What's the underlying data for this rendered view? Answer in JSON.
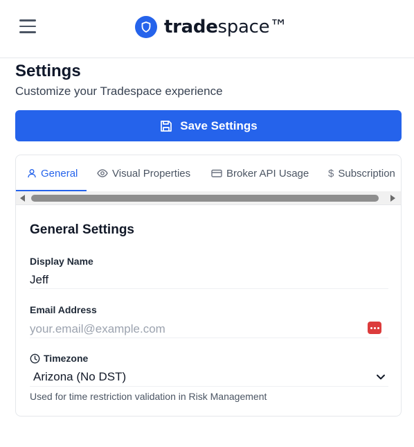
{
  "header": {
    "logo_bold": "trade",
    "logo_light": "space™",
    "menu_icon": "hamburger-menu-icon",
    "logo_icon": "shield-icon"
  },
  "page": {
    "title": "Settings",
    "subtitle": "Customize your Tradespace experience"
  },
  "save_button": {
    "label": "Save Settings",
    "icon": "floppy-disk-icon"
  },
  "tabs": [
    {
      "label": "General",
      "icon": "user-icon",
      "active": true
    },
    {
      "label": "Visual Properties",
      "icon": "eye-icon",
      "active": false
    },
    {
      "label": "Broker API Usage",
      "icon": "credit-card-icon",
      "active": false
    },
    {
      "label": "Subscription",
      "icon": "dollar-icon",
      "active": false
    }
  ],
  "general": {
    "section_title": "General Settings",
    "display_name": {
      "label": "Display Name",
      "value": "Jeff"
    },
    "email": {
      "label": "Email Address",
      "placeholder": "your.email@example.com",
      "value": ""
    },
    "timezone": {
      "label": "Timezone",
      "icon": "clock-icon",
      "selected": "Arizona (No DST)",
      "hint": "Used for time restriction validation in Risk Management"
    }
  },
  "colors": {
    "accent": "#2563eb",
    "text": "#0f172a",
    "muted": "#4b5563",
    "password_badge": "#dc3c3c"
  }
}
